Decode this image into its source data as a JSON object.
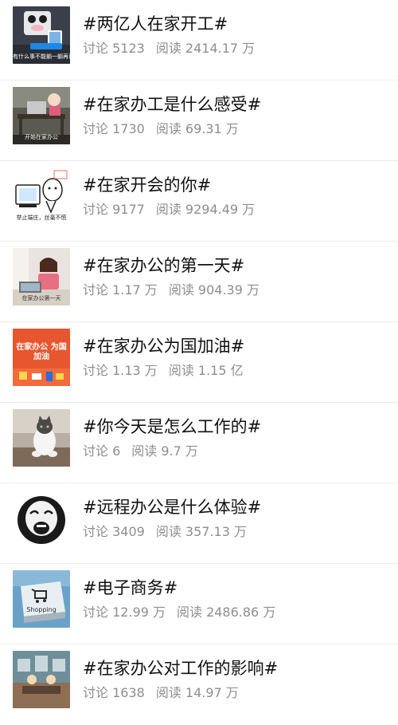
{
  "topics": [
    {
      "title": "#两亿人在家开工#",
      "discuss": "讨论 5123",
      "read": "阅读 2414.17 万",
      "thumb_icon": "cat-phone-thumbnail-icon",
      "thumb_caption": "有什么事不能躺一躺再说"
    },
    {
      "title": "#在家办工是什么感受#",
      "discuss": "讨论 1730",
      "read": "阅读 69.31 万",
      "thumb_icon": "laptop-desk-thumbnail-icon",
      "thumb_caption": "开始在家办公"
    },
    {
      "title": "#在家开会的你#",
      "discuss": "讨论 9177",
      "read": "阅读 9294.49 万",
      "thumb_icon": "cartoon-meeting-thumbnail-icon",
      "thumb_caption": "举止端庄，丝毫不慌"
    },
    {
      "title": "#在家办公的第一天#",
      "discuss": "讨论 1.17 万",
      "read": "阅读 904.39 万",
      "thumb_icon": "woman-laptop-thumbnail-icon",
      "thumb_caption": "在家办公第一天"
    },
    {
      "title": "#在家办公为国加油#",
      "discuss": "讨论 1.13 万",
      "read": "阅读 1.15 亿",
      "thumb_icon": "poster-thumbnail-icon",
      "thumb_caption": "在家办公 为国加油"
    },
    {
      "title": "#你今天是怎么工作的#",
      "discuss": "讨论 6",
      "read": "阅读 9.7 万",
      "thumb_icon": "sitting-cat-thumbnail-icon",
      "thumb_caption": ""
    },
    {
      "title": "#远程办公是什么体验#",
      "discuss": "讨论 3409",
      "read": "阅读 357.13 万",
      "thumb_icon": "panda-meme-thumbnail-icon",
      "thumb_caption": ""
    },
    {
      "title": "#电子商务#",
      "discuss": "讨论 12.99 万",
      "read": "阅读 2486.86 万",
      "thumb_icon": "shopping-key-thumbnail-icon",
      "thumb_caption": "Shopping"
    },
    {
      "title": "#在家办公对工作的影响#",
      "discuss": "讨论 1638",
      "read": "阅读 14.97 万",
      "thumb_icon": "cartoon-room-thumbnail-icon",
      "thumb_caption": ""
    }
  ]
}
